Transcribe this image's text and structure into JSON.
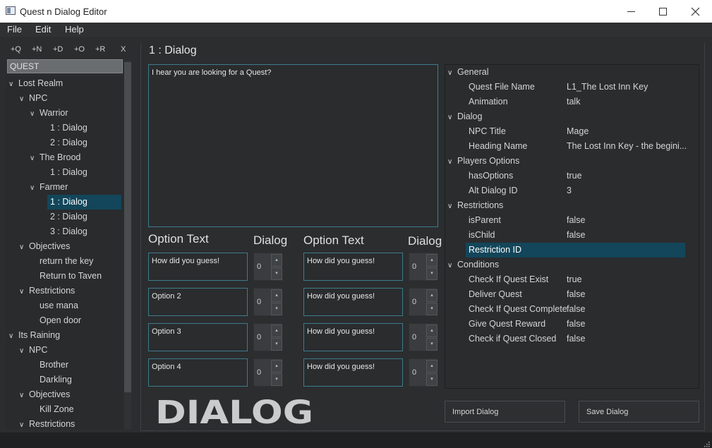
{
  "window": {
    "title": "Quest n Dialog Editor"
  },
  "menu": [
    "File",
    "Edit",
    "Help"
  ],
  "toolbar": [
    "+Q",
    "+N",
    "+D",
    "+O",
    "+R",
    "X"
  ],
  "search": {
    "value": "QUEST"
  },
  "tree": [
    {
      "label": "Lost Realm",
      "level": 0,
      "expanded": true
    },
    {
      "label": "NPC",
      "level": 1,
      "expanded": true
    },
    {
      "label": "Warrior",
      "level": 2,
      "expanded": true
    },
    {
      "label": "1 : Dialog",
      "level": 3
    },
    {
      "label": "2 : Dialog",
      "level": 3
    },
    {
      "label": "The Brood",
      "level": 2,
      "expanded": true
    },
    {
      "label": "1 : Dialog",
      "level": 3
    },
    {
      "label": "Farmer",
      "level": 2,
      "expanded": true
    },
    {
      "label": "1 : Dialog",
      "level": 3,
      "selected": true
    },
    {
      "label": "2 : Dialog",
      "level": 3
    },
    {
      "label": "3 : Dialog",
      "level": 3
    },
    {
      "label": "Objectives",
      "level": 1,
      "expanded": true
    },
    {
      "label": "return the key",
      "level": 2
    },
    {
      "label": "Return to Taven",
      "level": 2
    },
    {
      "label": "Restrictions",
      "level": 1,
      "expanded": true
    },
    {
      "label": "use mana",
      "level": 2
    },
    {
      "label": "Open door",
      "level": 2
    },
    {
      "label": "Its Raining",
      "level": 0,
      "expanded": true
    },
    {
      "label": "NPC",
      "level": 1,
      "expanded": true
    },
    {
      "label": "Brother",
      "level": 2
    },
    {
      "label": "Darkling",
      "level": 2
    },
    {
      "label": "Objectives",
      "level": 1,
      "expanded": true
    },
    {
      "label": "Kill Zone",
      "level": 2
    },
    {
      "label": "Restrictions",
      "level": 1,
      "expanded": true
    }
  ],
  "editor": {
    "heading": "1 : Dialog",
    "dialog_text": "I hear you are looking for a Quest?",
    "option_text_label": "Option Text",
    "dialog_label": "Dialog",
    "left_options": [
      {
        "text": "How did you guess!",
        "dialog": "0"
      },
      {
        "text": "Option 2",
        "dialog": "0"
      },
      {
        "text": "Option 3",
        "dialog": "0"
      },
      {
        "text": "Option 4",
        "dialog": "0"
      }
    ],
    "right_options": [
      {
        "text": "How did you guess!",
        "dialog": "0"
      },
      {
        "text": "How did you guess!",
        "dialog": "0"
      },
      {
        "text": "How did you guess!",
        "dialog": "0"
      },
      {
        "text": "How did you guess!",
        "dialog": "0"
      }
    ]
  },
  "properties": [
    {
      "category": "General",
      "items": [
        {
          "name": "Quest File Name",
          "value": "L1_The Lost Inn Key"
        },
        {
          "name": "Animation",
          "value": "talk"
        }
      ]
    },
    {
      "category": "Dialog",
      "items": [
        {
          "name": "NPC Title",
          "value": "Mage"
        },
        {
          "name": "Heading Name",
          "value": "The Lost Inn Key - the begini..."
        }
      ]
    },
    {
      "category": "Players Options",
      "items": [
        {
          "name": "hasOptions",
          "value": "true"
        },
        {
          "name": "Alt Dialog ID",
          "value": "3"
        }
      ]
    },
    {
      "category": "Restrictions",
      "items": [
        {
          "name": "isParent",
          "value": "false"
        },
        {
          "name": "isChild",
          "value": "false"
        },
        {
          "name": "Restriction ID",
          "value": "",
          "selected": true
        }
      ]
    },
    {
      "category": "Conditions",
      "items": [
        {
          "name": "Check If Quest Exist",
          "value": "true"
        },
        {
          "name": "Deliver Quest",
          "value": "false"
        },
        {
          "name": "Check If Quest Complete",
          "value": "false"
        },
        {
          "name": "Give Quest Reward",
          "value": "false"
        },
        {
          "name": "Check if Quest Closed",
          "value": "false"
        }
      ]
    }
  ],
  "logo": {
    "text": "DIALOG"
  },
  "buttons": {
    "import": "Import Dialog",
    "save": "Save Dialog"
  },
  "colors": {
    "accent": "#13465a",
    "border_accent": "#3e7b8a",
    "background": "#2b2d2f"
  }
}
